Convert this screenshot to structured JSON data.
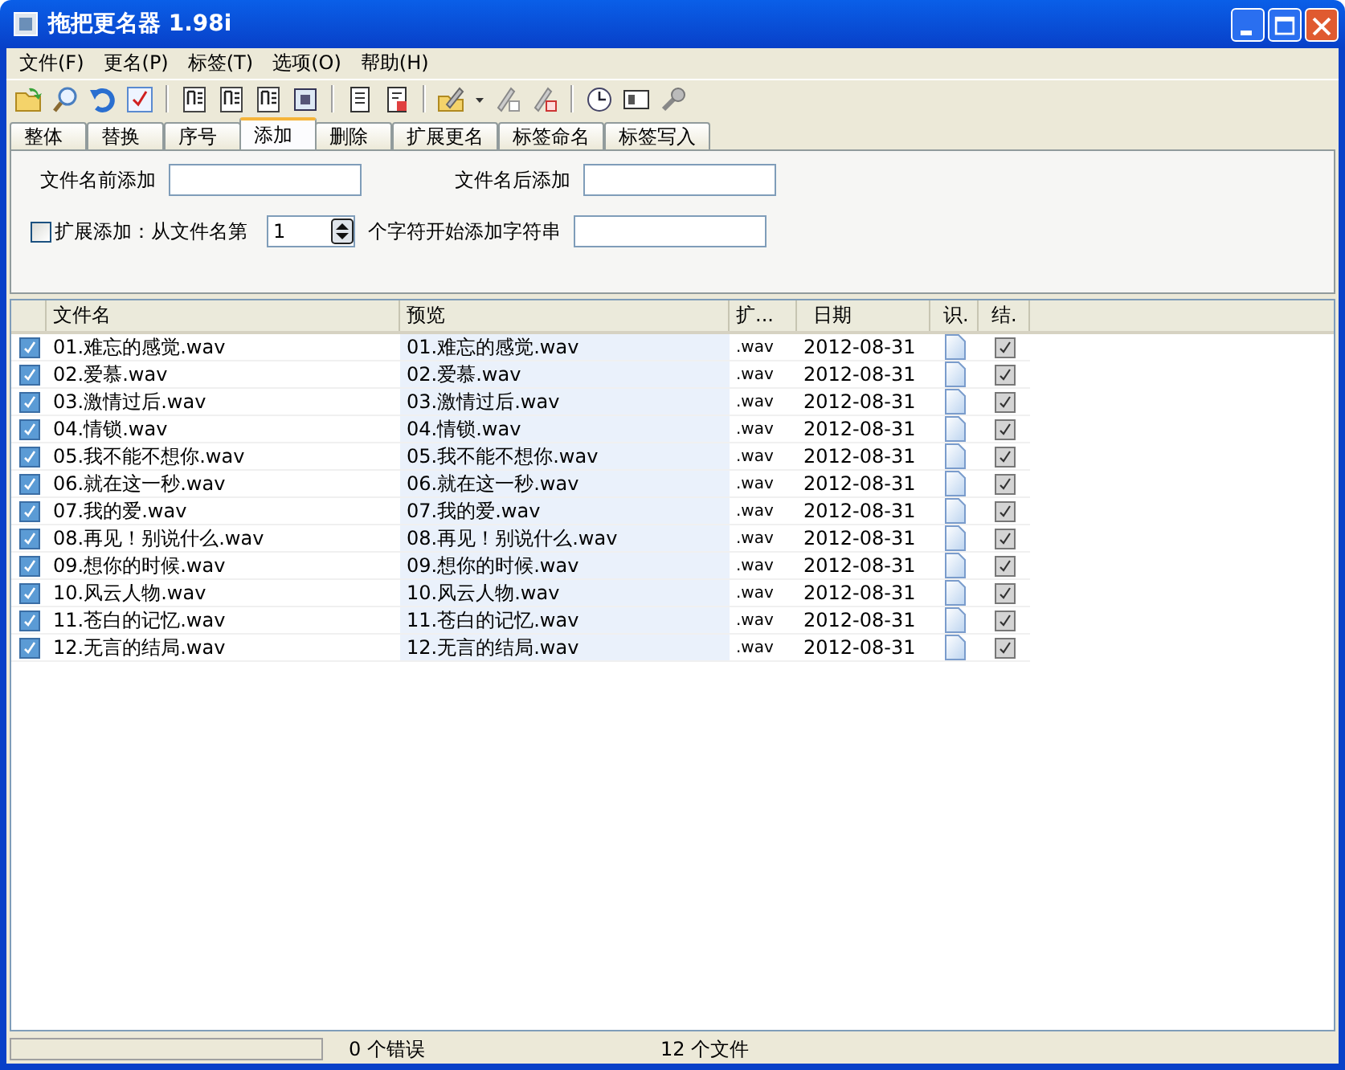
{
  "window": {
    "title": "拖把更名器 1.98i"
  },
  "menu": [
    {
      "label": "文件(F)"
    },
    {
      "label": "更名(P)"
    },
    {
      "label": "标签(T)"
    },
    {
      "label": "选项(O)"
    },
    {
      "label": "帮助(H)"
    }
  ],
  "tabs": [
    {
      "label": "整体",
      "selected": false
    },
    {
      "label": "替换",
      "selected": false
    },
    {
      "label": "序号",
      "selected": false
    },
    {
      "label": "添加",
      "selected": true
    },
    {
      "label": "删除",
      "selected": false
    },
    {
      "label": "扩展更名",
      "selected": false
    },
    {
      "label": "标签命名",
      "selected": false
    },
    {
      "label": "标签写入",
      "selected": false
    }
  ],
  "add_panel": {
    "prefix_label": "文件名前添加",
    "suffix_label": "文件名后添加",
    "extend": {
      "label": "扩展添加：从文件名第",
      "checked": false
    },
    "position_value": "1",
    "position_label": "个字符开始添加字符串"
  },
  "table": {
    "columns": [
      "文件名",
      "预览",
      "扩...",
      "日期",
      "识.",
      "结."
    ],
    "rows": [
      {
        "checked": true,
        "name": "01.难忘的感觉.wav",
        "preview": "01.难忘的感觉.wav",
        "ext": ".wav",
        "date": "2012-08-31",
        "result": true
      },
      {
        "checked": true,
        "name": "02.爱慕.wav",
        "preview": "02.爱慕.wav",
        "ext": ".wav",
        "date": "2012-08-31",
        "result": true
      },
      {
        "checked": true,
        "name": "03.激情过后.wav",
        "preview": "03.激情过后.wav",
        "ext": ".wav",
        "date": "2012-08-31",
        "result": true
      },
      {
        "checked": true,
        "name": "04.情锁.wav",
        "preview": "04.情锁.wav",
        "ext": ".wav",
        "date": "2012-08-31",
        "result": true
      },
      {
        "checked": true,
        "name": "05.我不能不想你.wav",
        "preview": "05.我不能不想你.wav",
        "ext": ".wav",
        "date": "2012-08-31",
        "result": true
      },
      {
        "checked": true,
        "name": "06.就在这一秒.wav",
        "preview": "06.就在这一秒.wav",
        "ext": ".wav",
        "date": "2012-08-31",
        "result": true
      },
      {
        "checked": true,
        "name": "07.我的爱.wav",
        "preview": "07.我的爱.wav",
        "ext": ".wav",
        "date": "2012-08-31",
        "result": true
      },
      {
        "checked": true,
        "name": "08.再见！别说什么.wav",
        "preview": "08.再见！别说什么.wav",
        "ext": ".wav",
        "date": "2012-08-31",
        "result": true
      },
      {
        "checked": true,
        "name": "09.想你的时候.wav",
        "preview": "09.想你的时候.wav",
        "ext": ".wav",
        "date": "2012-08-31",
        "result": true
      },
      {
        "checked": true,
        "name": "10.风云人物.wav",
        "preview": "10.风云人物.wav",
        "ext": ".wav",
        "date": "2012-08-31",
        "result": true
      },
      {
        "checked": true,
        "name": "11.苍白的记忆.wav",
        "preview": "11.苍白的记忆.wav",
        "ext": ".wav",
        "date": "2012-08-31",
        "result": true
      },
      {
        "checked": true,
        "name": "12.无言的结局.wav",
        "preview": "12.无言的结局.wav",
        "ext": ".wav",
        "date": "2012-08-31",
        "result": true
      }
    ]
  },
  "status_bar": {
    "progress": {
      "level": 0
    },
    "errors": "0 个错误",
    "files": "12 个文件"
  }
}
